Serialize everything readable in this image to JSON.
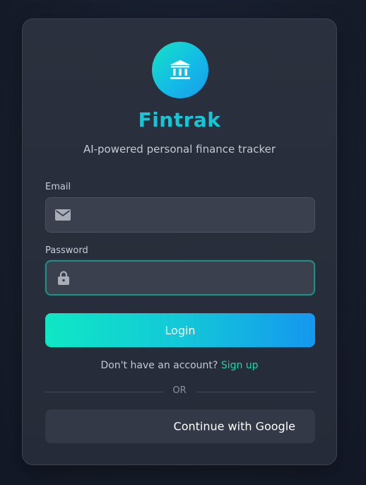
{
  "app": {
    "name": "Fintrak",
    "tagline": "AI-powered personal finance tracker",
    "logo_icon": "bank-icon"
  },
  "form": {
    "email_label": "Email",
    "email_value": "",
    "email_icon": "mail-icon",
    "password_label": "Password",
    "password_value": "",
    "password_icon": "lock-icon",
    "login_label": "Login"
  },
  "signup": {
    "prompt": "Don't have an account?",
    "link_label": "Sign up"
  },
  "divider": {
    "label": "OR"
  },
  "google": {
    "label": "Continue with Google"
  },
  "colors": {
    "brand": "#17c6d6",
    "accent_start": "#0fe7c5",
    "accent_end": "#1597ee",
    "link": "#19d6a8"
  }
}
